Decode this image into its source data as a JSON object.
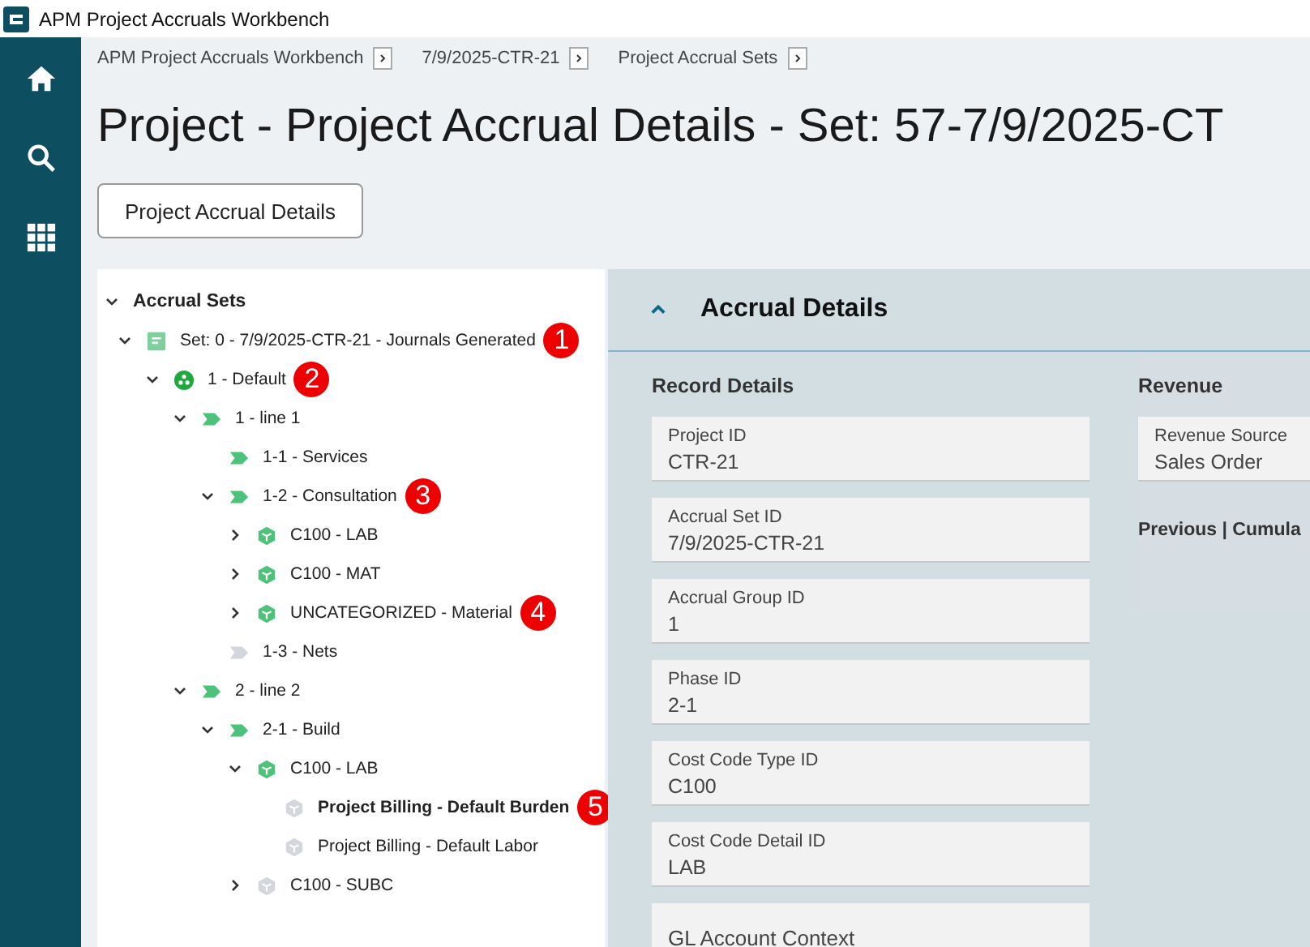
{
  "window": {
    "title": "APM Project Accruals Workbench"
  },
  "breadcrumbs": [
    "APM Project Accruals Workbench",
    "7/9/2025-CTR-21",
    "Project Accrual Sets"
  ],
  "page_title": "Project - Project Accrual Details - Set: 57-7/9/2025-CT",
  "action_button": "Project Accrual Details",
  "tree": {
    "title": "Accrual Sets",
    "expanded": true,
    "items": [
      {
        "label": "Set: 0 - 7/9/2025-CTR-21 - Journals Generated",
        "kind": "document",
        "color": "#7fcf9c",
        "expanded": true,
        "selected": false,
        "callout": "1",
        "children": [
          {
            "label": "1 - Default",
            "kind": "group",
            "color": "#1fa83c",
            "expanded": true,
            "selected": false,
            "callout": "2",
            "children": [
              {
                "label": "1 - line 1",
                "kind": "phase",
                "color": "#4cc27a",
                "expanded": true,
                "selected": false,
                "children": [
                  {
                    "label": "1-1 - Services",
                    "kind": "phase",
                    "color": "#4cc27a",
                    "selected": false
                  },
                  {
                    "label": "1-2 - Consultation",
                    "kind": "phase",
                    "color": "#4cc27a",
                    "expanded": true,
                    "selected": false,
                    "callout": "3",
                    "children": [
                      {
                        "label": "C100 - LAB",
                        "kind": "cube",
                        "color": "#4cc27a",
                        "expanded": false,
                        "selected": false
                      },
                      {
                        "label": "C100 - MAT",
                        "kind": "cube",
                        "color": "#4cc27a",
                        "expanded": false,
                        "selected": false
                      },
                      {
                        "label": "UNCATEGORIZED - Material",
                        "kind": "cube",
                        "color": "#4cc27a",
                        "expanded": false,
                        "selected": false,
                        "callout": "4"
                      }
                    ]
                  },
                  {
                    "label": "1-3 - Nets",
                    "kind": "phase",
                    "color": "#d3d6dc",
                    "selected": false
                  }
                ]
              },
              {
                "label": "2 - line 2",
                "kind": "phase",
                "color": "#4cc27a",
                "expanded": true,
                "selected": false,
                "children": [
                  {
                    "label": "2-1 - Build",
                    "kind": "phase",
                    "color": "#4cc27a",
                    "expanded": true,
                    "selected": false,
                    "children": [
                      {
                        "label": "C100 - LAB",
                        "kind": "cube",
                        "color": "#4cc27a",
                        "expanded": true,
                        "selected": false,
                        "children": [
                          {
                            "label": "Project Billing - Default Burden",
                            "kind": "cube",
                            "color": "#d3d6dc",
                            "selected": true,
                            "callout": "5"
                          },
                          {
                            "label": "Project Billing - Default Labor",
                            "kind": "cube",
                            "color": "#d3d6dc",
                            "selected": false
                          }
                        ]
                      },
                      {
                        "label": "C100 - SUBC",
                        "kind": "cube",
                        "color": "#d3d6dc",
                        "expanded": false,
                        "selected": false
                      }
                    ]
                  }
                ]
              }
            ]
          }
        ]
      }
    ]
  },
  "details": {
    "title": "Accrual Details",
    "expanded": true,
    "record": {
      "title": "Record Details",
      "fields": [
        {
          "label": "Project ID",
          "value": "CTR-21"
        },
        {
          "label": "Accrual Set ID",
          "value": "7/9/2025-CTR-21"
        },
        {
          "label": "Accrual Group ID",
          "value": "1"
        },
        {
          "label": "Phase ID",
          "value": "2-1"
        },
        {
          "label": "Cost Code Type ID",
          "value": "C100"
        },
        {
          "label": "Cost Code Detail ID",
          "value": "LAB"
        },
        {
          "label": "GL Account Context"
        }
      ]
    },
    "revenue": {
      "title": "Revenue",
      "fields": [
        {
          "label": "Revenue Source",
          "value": "Sales Order"
        }
      ],
      "subtitle": "Previous | Cumula"
    }
  }
}
